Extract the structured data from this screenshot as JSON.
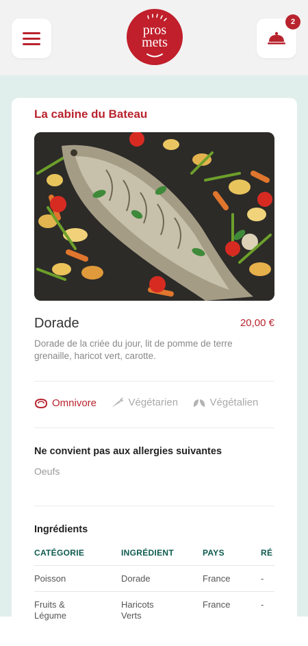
{
  "header": {
    "logo_line1": "pros",
    "logo_line2": "mets",
    "cart_count": "2"
  },
  "restaurant": {
    "name": "La cabine du Bateau"
  },
  "dish": {
    "name": "Dorade",
    "price": "20,00 €",
    "description": "Dorade de la criée du jour, lit de pomme de terre grenaille, haricot vert, carotte."
  },
  "diet": {
    "options": [
      {
        "label": "Omnivore",
        "icon": "meat-icon",
        "active": true
      },
      {
        "label": "Végétarien",
        "icon": "carrot-icon",
        "active": false
      },
      {
        "label": "Végétalien",
        "icon": "leaf-icon",
        "active": false
      }
    ]
  },
  "allergies": {
    "title": "Ne convient pas aux allergies suivantes",
    "items": [
      "Oeufs"
    ]
  },
  "ingredients": {
    "title": "Ingrédients",
    "columns": [
      "CATÉGORIE",
      "INGRÉDIENT",
      "PAYS",
      "RÉ"
    ],
    "rows": [
      [
        "Poisson",
        "Dorade",
        "France",
        "-"
      ],
      [
        "Fruits &\nLégume",
        "Haricots\nVerts",
        "France",
        "-"
      ]
    ]
  },
  "colors": {
    "brand_red": "#b8232d",
    "header_bg": "#f2f2f2",
    "content_bg": "#e1efec",
    "table_header_green": "#0d5a4e"
  }
}
